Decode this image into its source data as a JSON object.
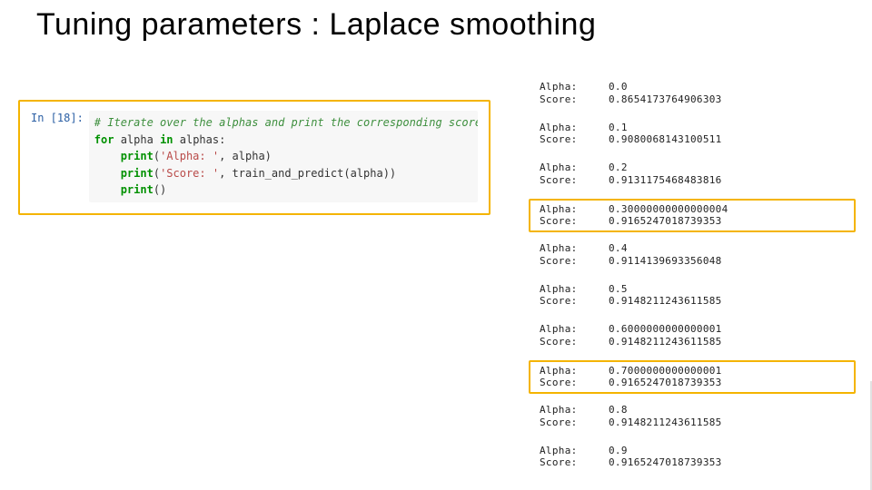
{
  "title": "Tuning parameters : Laplace smoothing",
  "code": {
    "prompt": "In [18]:",
    "comment": "# Iterate over the alphas and print the corresponding score",
    "for_kw": "for",
    "for_rest": " alpha ",
    "in_kw": "in",
    "for_tail": " alphas:",
    "print_kw": "print",
    "line_print1_a": "(",
    "line_print1_str": "'Alpha: '",
    "line_print1_b": ", alpha)",
    "line_print2_a": "(",
    "line_print2_str": "'Score: '",
    "line_print2_b": ", train_and_predict(alpha))",
    "line_print3": "()"
  },
  "labels": {
    "alpha": "Alpha:",
    "score": "Score:"
  },
  "results": [
    {
      "alpha": "0.0",
      "score": "0.8654173764906303",
      "hi": false
    },
    {
      "alpha": "0.1",
      "score": "0.9080068143100511",
      "hi": false
    },
    {
      "alpha": "0.2",
      "score": "0.9131175468483816",
      "hi": false
    },
    {
      "alpha": "0.30000000000000004",
      "score": "0.9165247018739353",
      "hi": true
    },
    {
      "alpha": "0.4",
      "score": "0.9114139693356048",
      "hi": false
    },
    {
      "alpha": "0.5",
      "score": "0.9148211243611585",
      "hi": false
    },
    {
      "alpha": "0.6000000000000001",
      "score": "0.9148211243611585",
      "hi": false
    },
    {
      "alpha": "0.7000000000000001",
      "score": "0.9165247018739353",
      "hi": true
    },
    {
      "alpha": "0.8",
      "score": "0.9148211243611585",
      "hi": false
    },
    {
      "alpha": "0.9",
      "score": "0.9165247018739353",
      "hi": false
    }
  ]
}
